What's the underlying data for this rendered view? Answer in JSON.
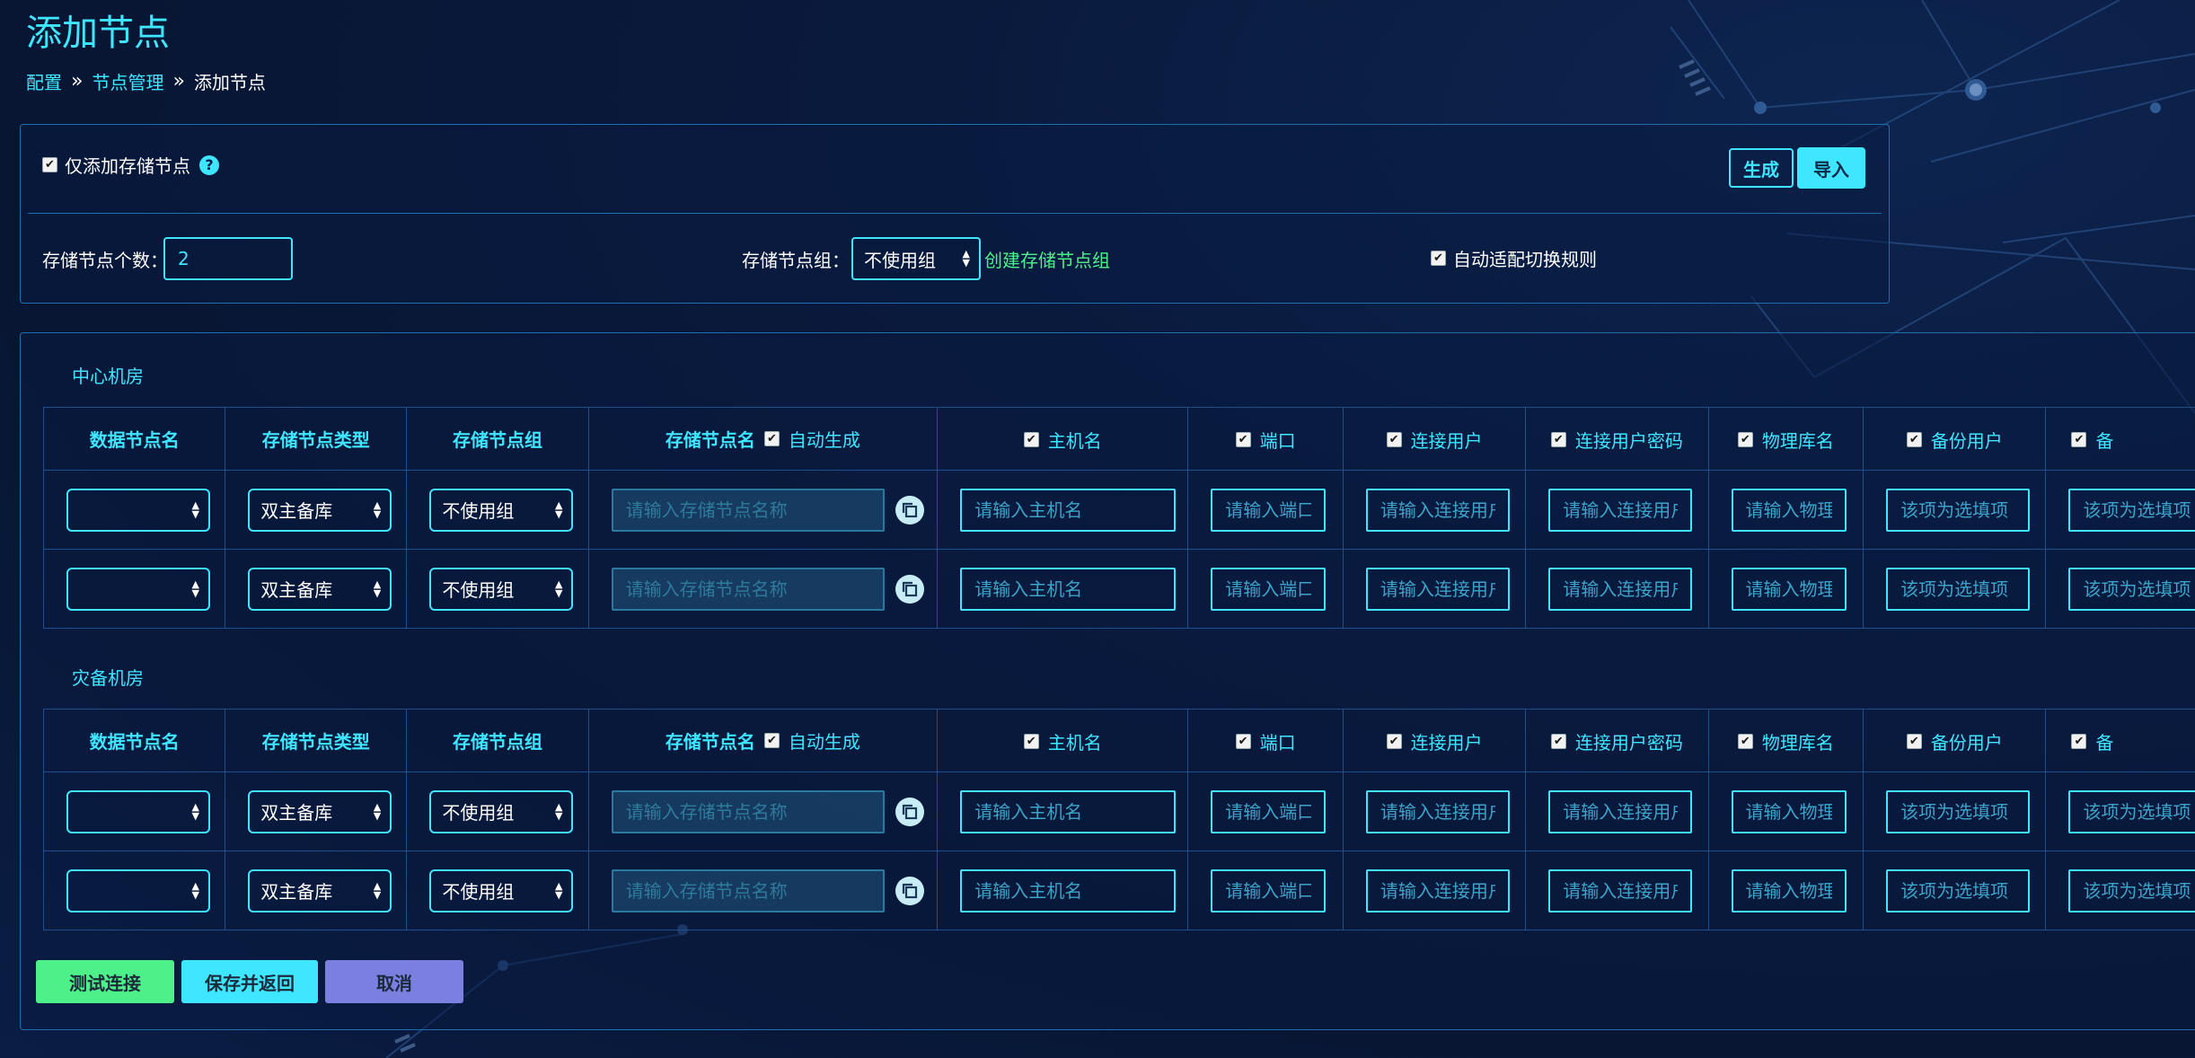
{
  "page": {
    "title": "添加节点"
  },
  "breadcrumb": [
    {
      "label": "配置"
    },
    {
      "label": "节点管理"
    },
    {
      "label": "添加节点"
    }
  ],
  "top_panel": {
    "only_storage_label": "仅添加存储节点",
    "only_storage_checked": true,
    "help_icon": "?",
    "generate_label": "生成",
    "import_label": "导入",
    "storage_count_label": "存储节点个数：",
    "storage_count_value": "2",
    "storage_group_label": "存储节点组：",
    "storage_group_value": "不使用组",
    "create_group_link": "创建存储节点组",
    "auto_switch_label": "自动适配切换规则",
    "auto_switch_checked": true
  },
  "columns": {
    "data_node_name": "数据节点名",
    "storage_node_type": "存储节点类型",
    "storage_node_group": "存储节点组",
    "storage_node_name": "存储节点名",
    "auto_generate": "自动生成",
    "hostname": "主机名",
    "port": "端口",
    "conn_user": "连接用户",
    "conn_password": "连接用户密码",
    "physical_db": "物理库名",
    "backup_user": "备份用户",
    "backup_pw_cut": "备"
  },
  "placeholders": {
    "storage_node_name": "请输入存储节点名称",
    "hostname": "请输入主机名",
    "port": "请输入端口",
    "conn_user": "请输入连接用户",
    "conn_password": "请输入连接用户密码",
    "physical_db": "请输入物理库名",
    "backup_user": "该项为选填项",
    "backup_password": "该项为选填项"
  },
  "sections": [
    {
      "title": "中心机房",
      "rows": [
        {
          "data_node": "",
          "node_type": "双主备库",
          "node_group": "不使用组"
        },
        {
          "data_node": "",
          "node_type": "双主备库",
          "node_group": "不使用组"
        }
      ]
    },
    {
      "title": "灾备机房",
      "rows": [
        {
          "data_node": "",
          "node_type": "双主备库",
          "node_group": "不使用组"
        },
        {
          "data_node": "",
          "node_type": "双主备库",
          "node_group": "不使用组"
        }
      ]
    }
  ],
  "actions": {
    "test_connection": "测试连接",
    "save_return": "保存并返回",
    "cancel": "取消"
  },
  "colors": {
    "accent": "#3ee6ff",
    "background": "#0a1a3d",
    "border": "#1f6eb0",
    "green": "#4ef08a",
    "test_button": "#4ef08a",
    "save_button": "#3ee6ff",
    "cancel_button": "#7b7fe0"
  }
}
